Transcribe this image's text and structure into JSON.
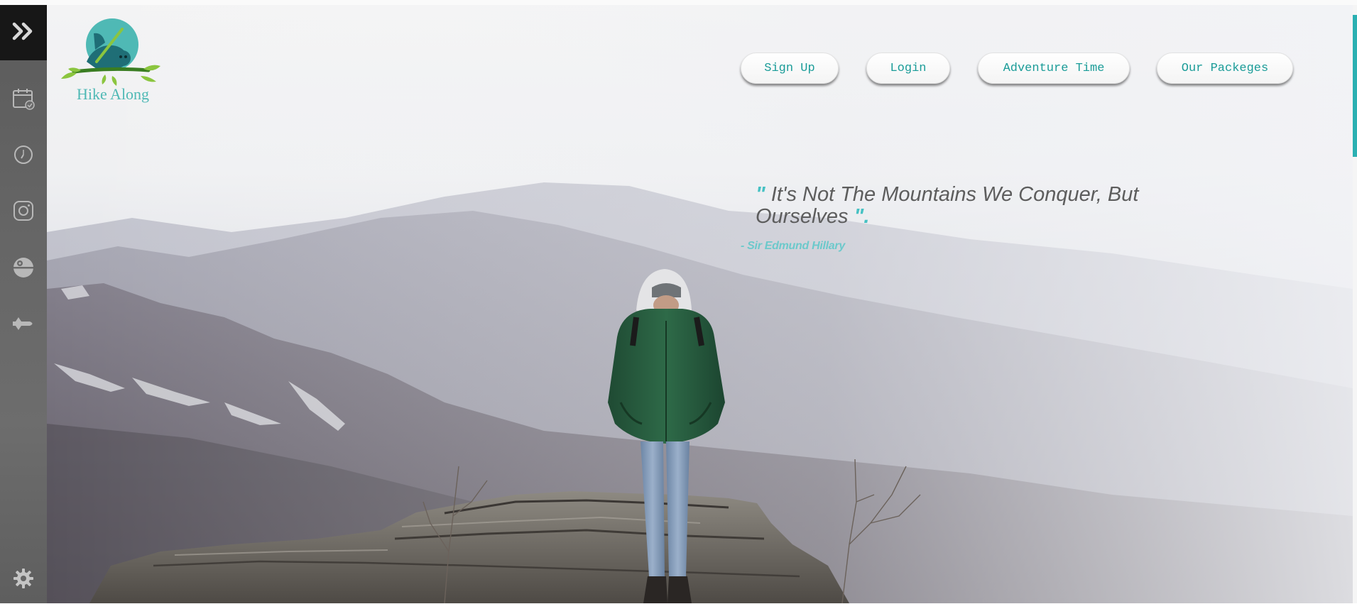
{
  "brand": {
    "name": "Hike Along"
  },
  "nav": {
    "signup": "Sign Up",
    "login": "Login",
    "adventure": "Adventure Time",
    "packages": "Our Packeges"
  },
  "quote": {
    "open_mark": "\"",
    "text": "It's Not The Mountains We Conquer, But Ourselves",
    "close_mark": "\".",
    "author": "- Sir Edmund Hillary"
  },
  "sidebar": {
    "items": [
      "double-chevron-right-icon",
      "calendar-check-icon",
      "clock-icon",
      "instagram-icon",
      "death-star-icon",
      "spaceship-icon",
      "gear-icon"
    ]
  },
  "colors": {
    "accent": "#1a9c98",
    "quote_mark": "#46c1c3",
    "sidebar_dark": "#171717"
  }
}
